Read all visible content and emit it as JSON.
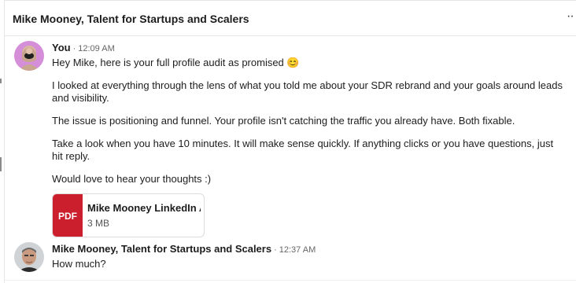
{
  "header": {
    "title": "Mike Mooney, Talent for Startups and Scalers",
    "more_icon": "more-horizontal-icon",
    "more_glyph": "··"
  },
  "messages": [
    {
      "sender": "You",
      "separator": "·",
      "time": "12:09 AM",
      "avatar_icon": "user-avatar-photo",
      "paragraphs": [
        "Hey Mike, here is your full profile audit as promised 😊",
        "I looked at everything through the lens of what you told me about your SDR rebrand and your goals around leads and visibility.",
        "The issue is positioning and funnel. Your profile isn't catching the traffic you already have. Both fixable.",
        "Take a look when you have 10 minutes. It will make sense quickly. If anything clicks or you have questions, just hit reply.",
        "Would love to hear your thoughts :)"
      ],
      "attachment": {
        "badge": "PDF",
        "name": "Mike Mooney LinkedIn A...",
        "size": "3 MB"
      }
    },
    {
      "sender": "Mike Mooney, Talent for Startups and Scalers",
      "separator": "·",
      "time": "12:37 AM",
      "avatar_icon": "contact-avatar-photo",
      "paragraphs": [
        "How much?"
      ]
    }
  ],
  "colors": {
    "pdf_badge": "#cc1f2e",
    "text": "#1d1d1d",
    "muted": "#666666",
    "border": "#e6e6e6"
  }
}
